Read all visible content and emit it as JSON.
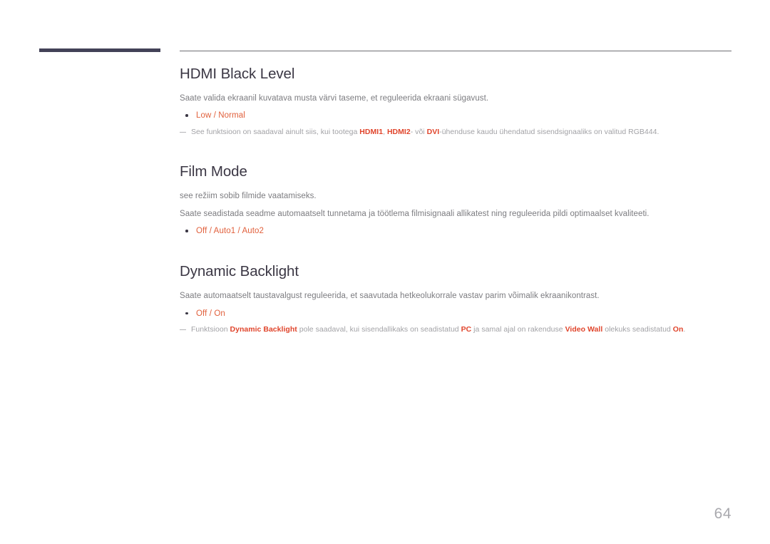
{
  "page": {
    "number": "64",
    "sections": [
      {
        "id": "hdmi-black-level",
        "heading": "HDMI Black Level",
        "paragraphs": [
          "Saate valida ekraanil kuvatava musta värvi taseme, et reguleerida ekraani sügavust."
        ],
        "options": [
          "Low / Normal"
        ],
        "note": {
          "parts": [
            {
              "text": "See funktsioon on saadaval ainult siis, kui tootega ",
              "highlight": false
            },
            {
              "text": "HDMI1",
              "highlight": true
            },
            {
              "text": ", ",
              "highlight": false
            },
            {
              "text": "HDMI2",
              "highlight": true
            },
            {
              "text": "- või ",
              "highlight": false
            },
            {
              "text": "DVI",
              "highlight": true
            },
            {
              "text": "-ühenduse kaudu ühendatud sisendsignaaliks on valitud RGB444.",
              "highlight": false
            }
          ]
        }
      },
      {
        "id": "film-mode",
        "heading": "Film Mode",
        "paragraphs": [
          "see režiim sobib filmide vaatamiseks.",
          "Saate seadistada seadme automaatselt tunnetama ja töötlema filmisignaali allikatest ning reguleerida pildi optimaalset kvaliteeti."
        ],
        "options": [
          "Off / Auto1 / Auto2"
        ],
        "note": null
      },
      {
        "id": "dynamic-backlight",
        "heading": "Dynamic Backlight",
        "paragraphs": [
          "Saate automaatselt taustavalgust reguleerida, et saavutada hetkeolukorrale vastav parim võimalik ekraanikontrast."
        ],
        "options": [
          "Off / On"
        ],
        "note": {
          "parts": [
            {
              "text": "Funktsioon ",
              "highlight": false
            },
            {
              "text": "Dynamic Backlight",
              "highlight": true
            },
            {
              "text": " pole saadaval, kui sisendallikaks on seadistatud ",
              "highlight": false
            },
            {
              "text": "PC",
              "highlight": true
            },
            {
              "text": " ja samal ajal on rakenduse ",
              "highlight": false
            },
            {
              "text": "Video Wall",
              "highlight": true
            },
            {
              "text": " olekuks seadistatud ",
              "highlight": false
            },
            {
              "text": "On",
              "highlight": true
            },
            {
              "text": ".",
              "highlight": false
            }
          ]
        }
      }
    ],
    "colors": {
      "heading": "#3b3744",
      "body": "#7c7c80",
      "option": "#e1603c",
      "note": "#a2a2a6",
      "highlight": "#e0452c",
      "corner_bar": "#434258",
      "rule": "#6e6e73",
      "page_number": "#a9a9ae"
    }
  }
}
